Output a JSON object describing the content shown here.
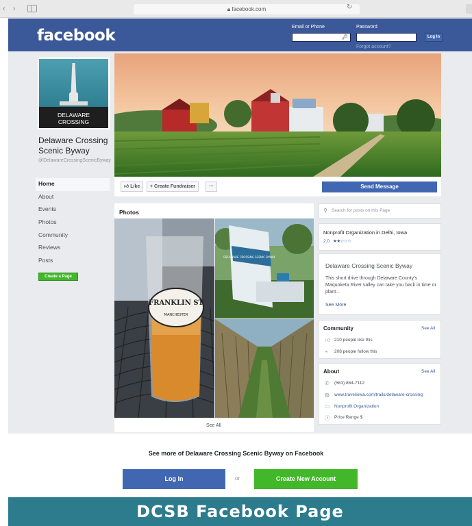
{
  "browser": {
    "url": "facebook.com"
  },
  "header": {
    "logo": "facebook",
    "email_label": "Email or Phone",
    "password_label": "Password",
    "login_button": "Log In",
    "forgot": "Forgot account?"
  },
  "profile": {
    "pic_text_line1": "DELAWARE",
    "pic_text_line2": "CROSSING",
    "name": "Delaware Crossing Scenic Byway",
    "handle": "@DelawareCrossingScenicByway"
  },
  "nav": {
    "items": [
      "Home",
      "About",
      "Events",
      "Photos",
      "Community",
      "Reviews",
      "Posts"
    ],
    "create_page": "Create a Page"
  },
  "actions": {
    "like": "Like",
    "fundraiser": "Create Fundraiser",
    "more": "···",
    "send_message": "Send Message"
  },
  "photos": {
    "title": "Photos",
    "see_all": "See All",
    "glass_text_1": "FRANKLIN ST",
    "glass_text_2": "MANCHESTER",
    "sign_text": "DELAWARE CROSSING SCENIC BYWAY"
  },
  "right": {
    "search_placeholder": "Search for posts on this Page",
    "category": "Nonprofit Organization in Delhi, Iowa",
    "rating": "2.0",
    "about_title": "Delaware Crossing Scenic Byway",
    "about_desc": "This short drive through Delaware County's Maquoketa River valley can take you back in time or plant...",
    "see_more": "See More",
    "community_title": "Community",
    "community_see_all": "See All",
    "likes": "210 people like this",
    "follows": "208 people follow this",
    "about_head": "About",
    "about_see_all": "See All",
    "phone": "(563) 864-7112",
    "website": "www.traveliowa.com/trails/delaware-crossing",
    "org_type": "Nonprofit Organization",
    "price": "Price Range $"
  },
  "bottom": {
    "see_more": "See more of Delaware Crossing Scenic Byway on Facebook",
    "login": "Log In",
    "or": "or",
    "create": "Create New Account"
  },
  "caption": "DCSB Facebook Page",
  "colors": {
    "fb_blue": "#3b5998",
    "button_blue": "#4267b2",
    "green": "#42b72a",
    "caption_teal": "#2d7c8d"
  }
}
